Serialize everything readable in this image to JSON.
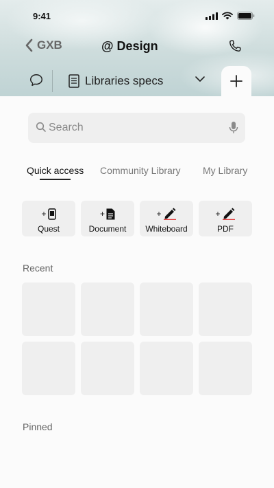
{
  "status": {
    "time": "9:41"
  },
  "nav": {
    "back_label": "GXB",
    "title": "@ Design"
  },
  "tabbar": {
    "doc_label": "Libraries specs"
  },
  "search": {
    "placeholder": "Search"
  },
  "library_tabs": [
    {
      "label": "Quick access",
      "active": true
    },
    {
      "label": "Community Library",
      "active": false
    },
    {
      "label": "My Library",
      "active": false
    }
  ],
  "quick_actions": [
    {
      "label": "Quest",
      "icon": "phone-icon"
    },
    {
      "label": "Document",
      "icon": "document-icon"
    },
    {
      "label": "Whiteboard",
      "icon": "pen-icon"
    },
    {
      "label": "PDF",
      "icon": "pen-icon"
    }
  ],
  "sections": {
    "recent": "Recent",
    "pinned": "Pinned"
  },
  "colors": {
    "sky": "#cddcdc",
    "tile": "#efefef",
    "accent_underline": "#e04040"
  }
}
